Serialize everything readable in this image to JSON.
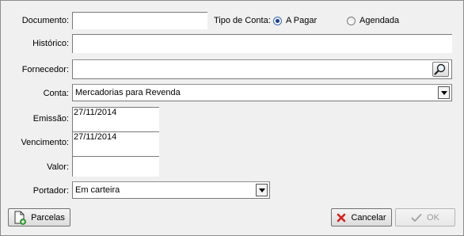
{
  "form": {
    "documento_label": "Documento:",
    "documento_value": "",
    "tipo_conta_label": "Tipo de Conta:",
    "tipo_conta_options": [
      "A Pagar",
      "Agendada"
    ],
    "tipo_conta_selected": "A Pagar",
    "historico_label": "Histórico:",
    "historico_value": "",
    "fornecedor_label": "Fornecedor:",
    "fornecedor_value": "",
    "conta_label": "Conta:",
    "conta_value": "Mercadorias para Revenda",
    "emissao_label": "Emissão:",
    "emissao_value": "27/11/2014",
    "vencimento_label": "Vencimento:",
    "vencimento_value": "27/11/2014",
    "valor_label": "Valor:",
    "valor_value": "",
    "portador_label": "Portador:",
    "portador_value": "Em carteira"
  },
  "buttons": {
    "parcelas": "Parcelas",
    "cancelar": "Cancelar",
    "ok": "OK"
  },
  "colors": {
    "cancel_icon": "#d42020",
    "add_icon": "#3aa53a",
    "radio_selected": "#1b3f8f"
  }
}
